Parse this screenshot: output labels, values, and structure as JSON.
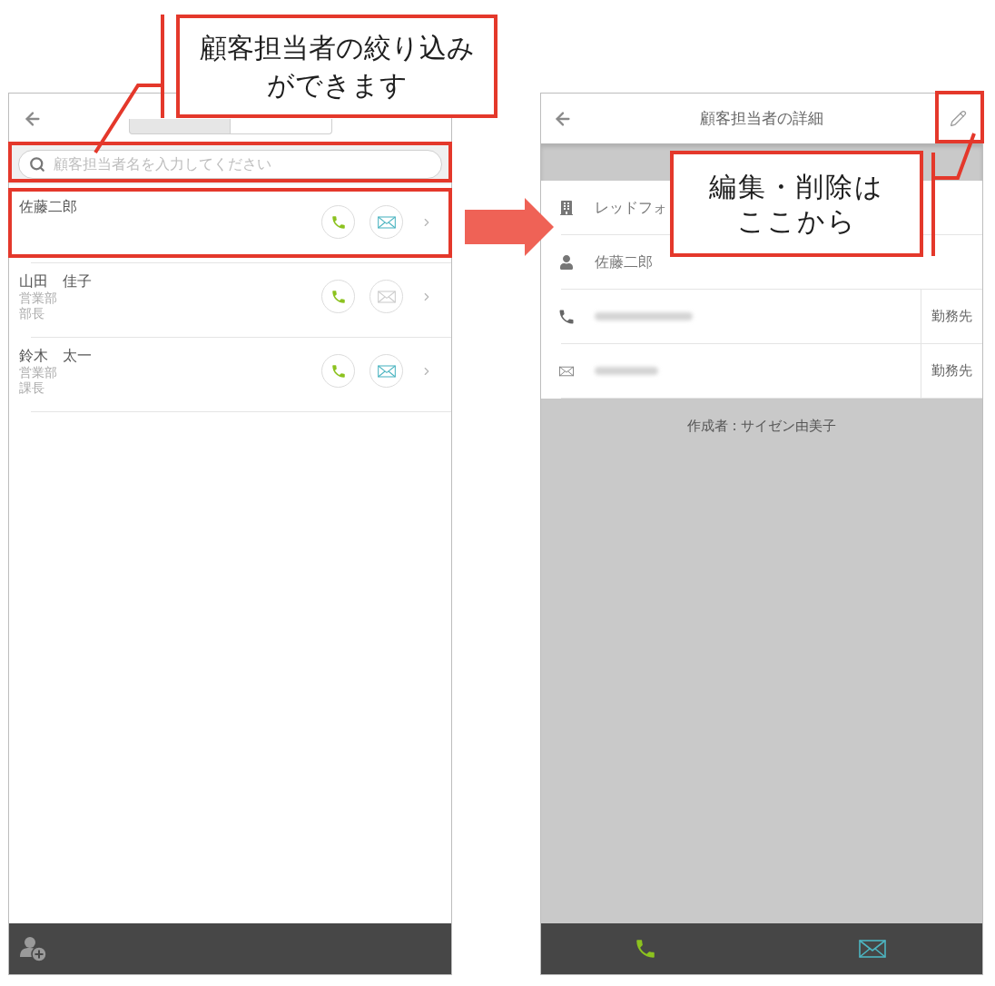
{
  "left_screen": {
    "tabs": [
      {
        "selected": true
      },
      {
        "selected": false
      }
    ],
    "search": {
      "placeholder": "顧客担当者名を入力してください"
    },
    "contacts": [
      {
        "name": "佐藤二郎",
        "mail_enabled": true
      },
      {
        "name": "山田　佳子",
        "details": [
          "営業部",
          "部長"
        ],
        "mail_enabled": false
      },
      {
        "name": "鈴木　太一",
        "details": [
          "営業部",
          "課長"
        ],
        "mail_enabled": true
      }
    ]
  },
  "right_screen": {
    "title": "顧客担当者の詳細",
    "fields": [
      {
        "kind": "company",
        "value": "レッドフォ"
      },
      {
        "kind": "person",
        "value": "佐藤二郎"
      },
      {
        "kind": "phone",
        "redacted": true,
        "tag": "勤務先"
      },
      {
        "kind": "email",
        "redacted": true,
        "tag": "勤務先"
      }
    ],
    "creator": "作成者 : サイゼン由美子"
  },
  "annotations": {
    "search_callout": {
      "lines": [
        "顧客担当者の絞り込み",
        "ができます"
      ]
    },
    "edit_callout": {
      "lines": [
        "編集・削除は",
        "ここから"
      ]
    }
  }
}
